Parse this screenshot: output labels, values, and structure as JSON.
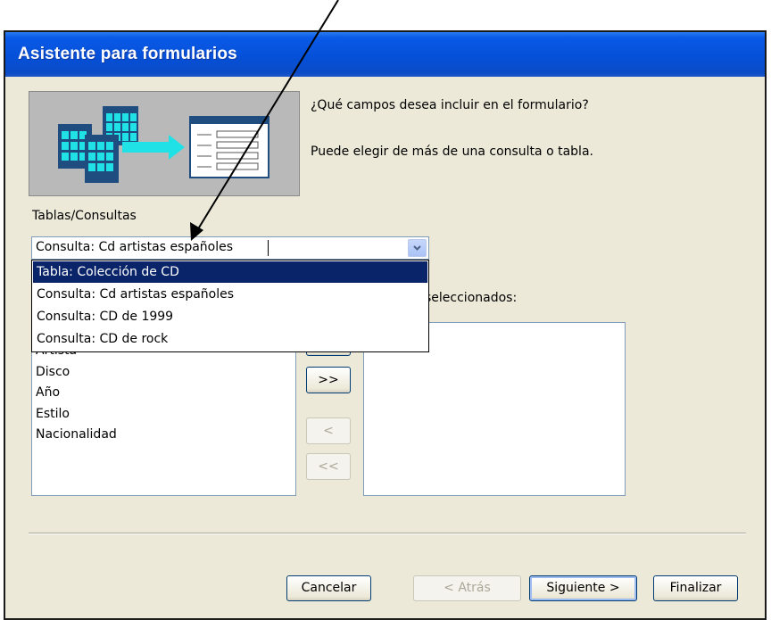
{
  "window": {
    "title": "Asistente para formularios"
  },
  "prompt": {
    "question": "¿Qué campos desea incluir en el formulario?",
    "hint": "Puede elegir de más de una consulta o tabla."
  },
  "tables_label": "Tablas/Consultas",
  "combo": {
    "value": "Consulta: Cd artistas españoles",
    "options": [
      "Tabla: Colección de CD",
      "Consulta: Cd artistas españoles",
      "Consulta: CD de 1999",
      "Consulta: CD de rock"
    ]
  },
  "selected_fields_label": "seleccionados:",
  "available_fields": [
    "Artista",
    "Disco",
    "Año",
    "Estilo",
    "Nacionalidad"
  ],
  "move_buttons": {
    "add_all": ">>",
    "remove_one": "<",
    "remove_all": "<<"
  },
  "footer": {
    "cancel": "Cancelar",
    "back": "< Atrás",
    "next": "Siguiente >",
    "finish": "Finalizar"
  },
  "colors": {
    "titlebar": "#0550d8",
    "dialog_bg": "#ece9d8",
    "selection": "#0a246a"
  }
}
